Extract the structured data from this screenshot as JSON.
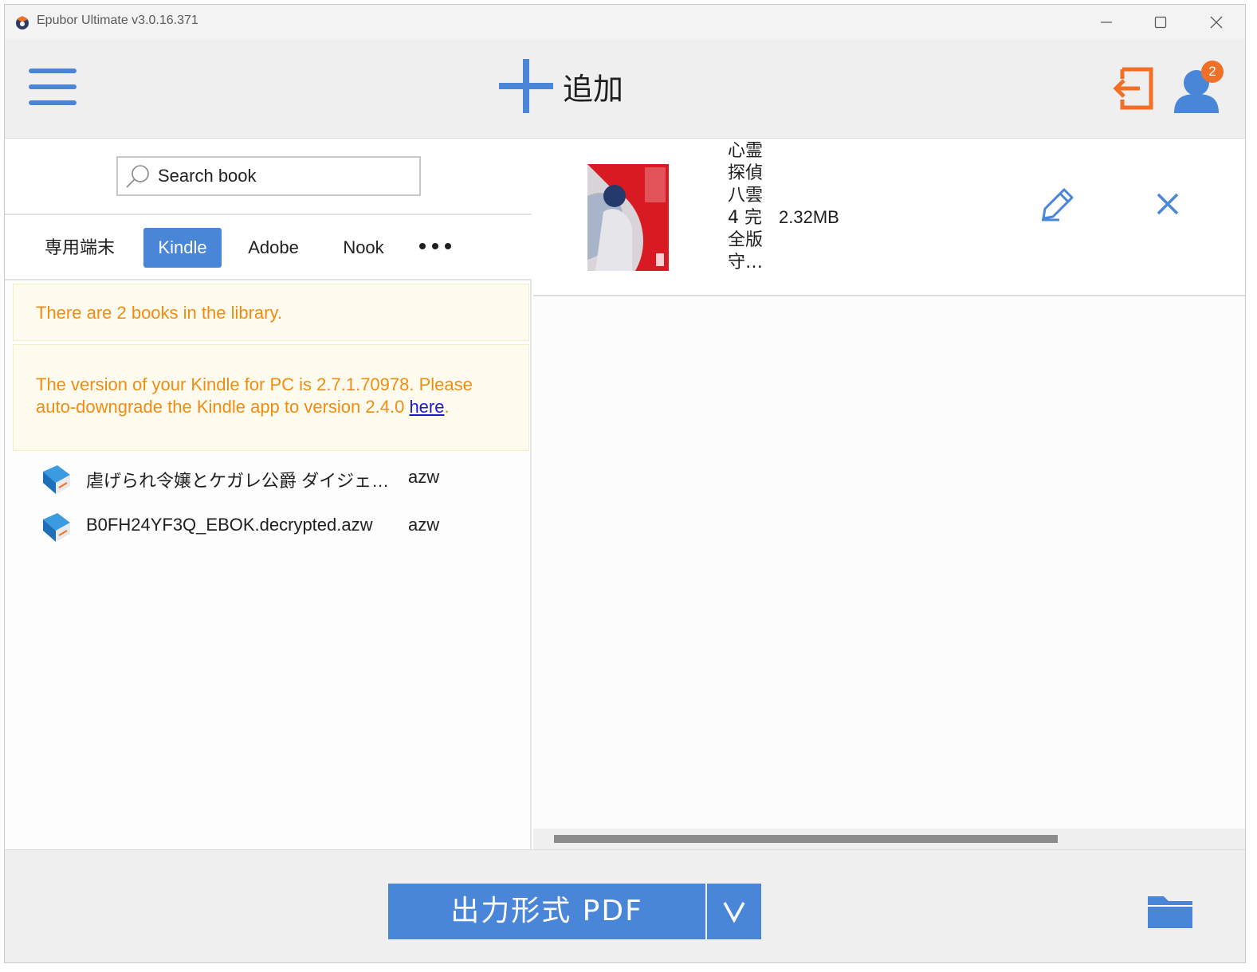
{
  "window": {
    "title": "Epubor Ultimate v3.0.16.371"
  },
  "toolbar": {
    "add_label": "追加",
    "user_badge": "2"
  },
  "search": {
    "placeholder": "Search book"
  },
  "tabs": [
    {
      "label": "専用端末",
      "active": false
    },
    {
      "label": "Kindle",
      "active": true
    },
    {
      "label": "Adobe",
      "active": false
    },
    {
      "label": "Nook",
      "active": false
    }
  ],
  "notices": {
    "library_count": "There are 2 books in the library.",
    "kindle_version_text": "The version of your Kindle for PC is 2.7.1.70978. Please auto-downgrade the Kindle app to version 2.4.0 ",
    "kindle_version_link": "here",
    "kindle_version_end": "."
  },
  "books": [
    {
      "title": "虐げられ令嬢とケガレ公爵 ダイジェスト版",
      "ext": "azw"
    },
    {
      "title": "B0FH24YF3Q_EBOK.decrypted.azw",
      "ext": "azw"
    }
  ],
  "conversion": {
    "title": "心霊探偵八雲4 完全版 守…",
    "size": "2.32MB"
  },
  "bottom": {
    "format_label": "出力形式 PDF"
  },
  "colors": {
    "accent": "#4a86d8",
    "notice_text": "#f08c12",
    "notice_bg": "#fffcef",
    "badge": "#f07028",
    "logout": "#f07028"
  }
}
